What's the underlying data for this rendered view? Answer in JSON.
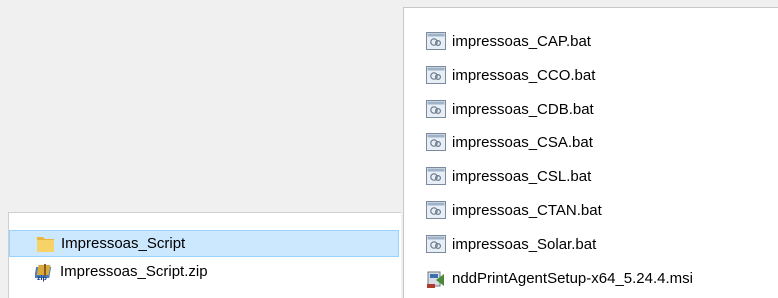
{
  "left_pane": {
    "items": [
      {
        "label": "Impressoas_Script",
        "icon": "folder-icon",
        "selected": true
      },
      {
        "label": "Impressoas_Script.zip",
        "icon": "zip-archive-icon",
        "selected": false
      }
    ]
  },
  "right_pane": {
    "files": [
      {
        "label": "impressoas_CAP.bat",
        "icon": "batch-file-icon"
      },
      {
        "label": "impressoas_CCO.bat",
        "icon": "batch-file-icon"
      },
      {
        "label": "impressoas_CDB.bat",
        "icon": "batch-file-icon"
      },
      {
        "label": "impressoas_CSA.bat",
        "icon": "batch-file-icon"
      },
      {
        "label": "impressoas_CSL.bat",
        "icon": "batch-file-icon"
      },
      {
        "label": "impressoas_CTAN.bat",
        "icon": "batch-file-icon"
      },
      {
        "label": "impressoas_Solar.bat",
        "icon": "batch-file-icon"
      },
      {
        "label": "nddPrintAgentSetup-x64_5.24.4.msi",
        "icon": "msi-installer-icon"
      }
    ]
  },
  "colors": {
    "selection_bg": "#cce8ff",
    "selection_border": "#99d1ff",
    "folder": "#f3c94f"
  }
}
